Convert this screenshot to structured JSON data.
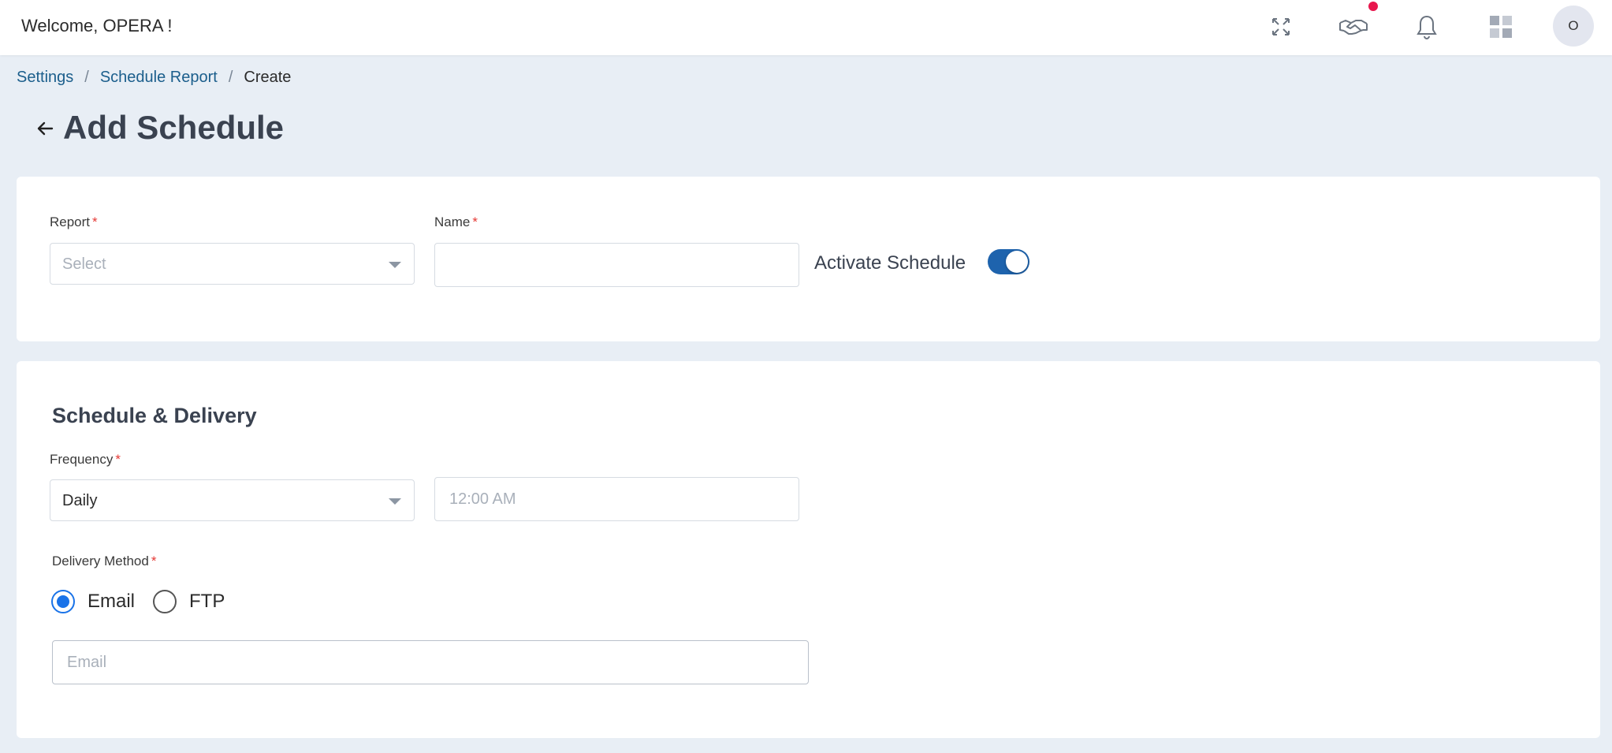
{
  "header": {
    "welcome": "Welcome, OPERA !",
    "avatar_initial": "O",
    "icons": [
      "fullscreen-icon",
      "handshake-icon",
      "bell-icon",
      "apps-grid-icon"
    ],
    "notification_color": "#e8174d"
  },
  "breadcrumb": {
    "items": [
      "Settings",
      "Schedule Report"
    ],
    "current": "Create",
    "separator": "/"
  },
  "page": {
    "title": "Add Schedule"
  },
  "form": {
    "report_label": "Report",
    "report_placeholder": "Select",
    "name_label": "Name",
    "name_value": "",
    "activate_label": "Activate Schedule",
    "activate_on": true,
    "required_mark": "*"
  },
  "schedule": {
    "section_title": "Schedule & Delivery",
    "frequency_label": "Frequency",
    "frequency_value": "Daily",
    "time_placeholder": "12:00 AM",
    "delivery_label": "Delivery Method",
    "delivery_options": [
      "Email",
      "FTP"
    ],
    "delivery_selected": "Email",
    "email_placeholder": "Email"
  },
  "colors": {
    "accent": "#1e63ad",
    "radio_accent": "#1a73e8",
    "link": "#1b5e8c",
    "required": "#e53935",
    "background": "#e8eef5"
  }
}
